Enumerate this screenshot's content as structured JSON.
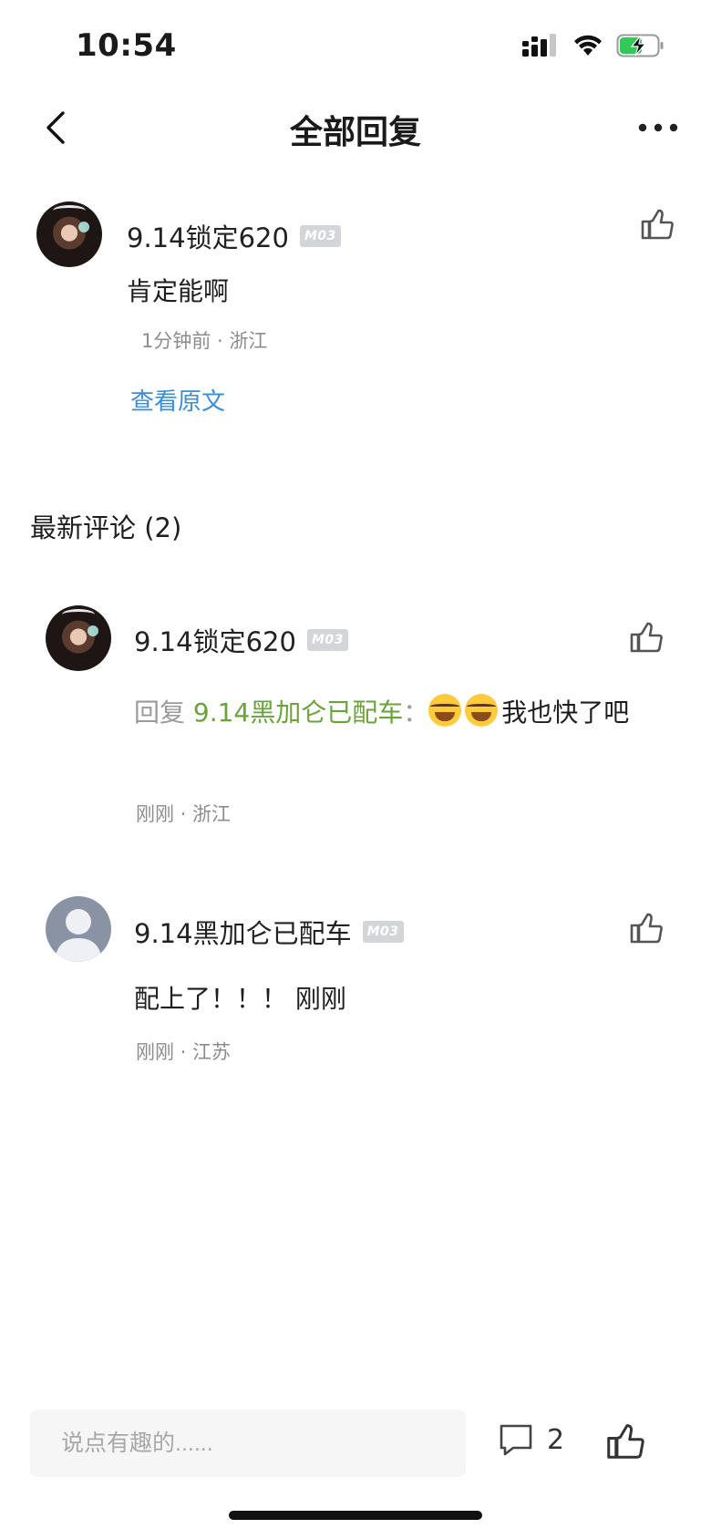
{
  "status_bar": {
    "time": "10:54"
  },
  "nav": {
    "title": "全部回复"
  },
  "main_comment": {
    "username": "9.14锁定620",
    "badge": "M03",
    "text": "肯定能啊",
    "meta": "1分钟前 · 浙江",
    "view_original": "查看原文"
  },
  "section": {
    "title": "最新评论 (2)"
  },
  "replies": [
    {
      "username": "9.14锁定620",
      "badge": "M03",
      "reply_prefix": "回复 ",
      "reply_target": "9.14黑加仑已配车",
      "reply_colon": "：",
      "text": "我也快了吧",
      "meta": "刚刚 · 浙江"
    },
    {
      "username": "9.14黑加仑已配车",
      "badge": "M03",
      "text": "配上了！！！ 刚刚",
      "meta": "刚刚 · 江苏"
    }
  ],
  "bottom_bar": {
    "input_placeholder": "说点有趣的......",
    "comment_count": "2"
  },
  "colors": {
    "link_blue": "#3a8ed8",
    "reply_target_green": "#6aa23b",
    "meta_gray": "#8c8c8c"
  }
}
